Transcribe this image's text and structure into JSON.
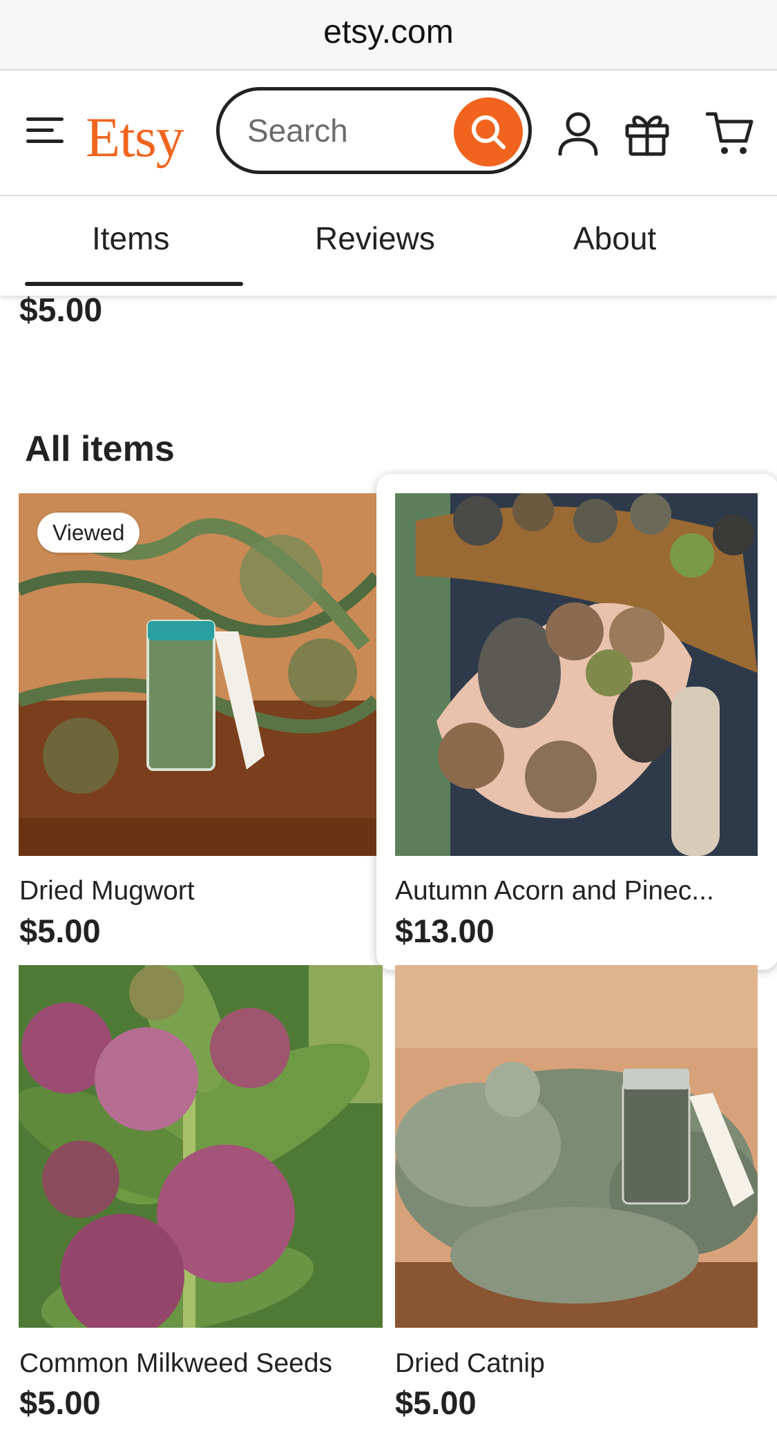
{
  "browser": {
    "url": "etsy.com"
  },
  "header": {
    "logo": "Etsy",
    "search_placeholder": "Search",
    "brand_color": "#f1641e"
  },
  "tabs": [
    {
      "label": "Items",
      "active": true
    },
    {
      "label": "Reviews",
      "active": false
    },
    {
      "label": "About",
      "active": false
    }
  ],
  "previous_item_price": "$5.00",
  "section_title": "All items",
  "products": [
    {
      "title": "Dried Mugwort",
      "price": "$5.00",
      "badge": "Viewed"
    },
    {
      "title": "Autumn Acorn and Pinec...",
      "price": "$13.00"
    },
    {
      "title": "Common Milkweed Seeds",
      "price": "$5.00"
    },
    {
      "title": "Dried Catnip",
      "price": "$5.00"
    }
  ]
}
